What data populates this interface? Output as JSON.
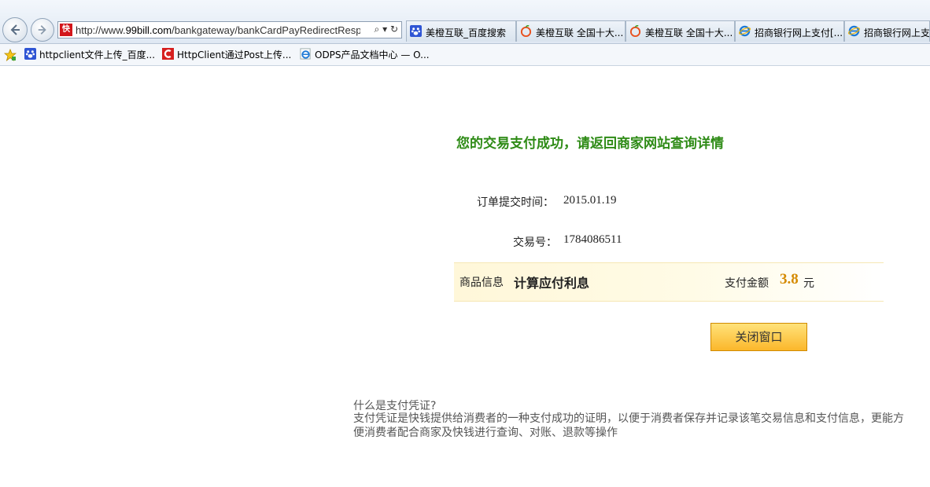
{
  "browser": {
    "url_prefix": "http://www.",
    "url_domain": "99bill.com",
    "url_path": "/bankgateway/bankCardPayRedirectResp",
    "favicon_text": "快",
    "tabs": [
      {
        "label": "美橙互联_百度搜索",
        "icon": "baidu-paw-icon"
      },
      {
        "label": "美橙互联 全国十大...",
        "icon": "apple-logo-icon"
      },
      {
        "label": "美橙互联 全国十大...",
        "icon": "apple-logo-icon"
      },
      {
        "label": "招商银行网上支付[...",
        "icon": "ie-icon"
      },
      {
        "label": "招商银行网上支",
        "icon": "ie-icon"
      }
    ],
    "favorites": [
      {
        "label": "httpclient文件上传_百度...",
        "icon": "baidu-paw-icon"
      },
      {
        "label": "HttpClient通过Post上传...",
        "icon": "c-logo-icon"
      },
      {
        "label": "ODPS产品文档中心 — O...",
        "icon": "ie-icon"
      }
    ]
  },
  "page": {
    "success_message": "您的交易支付成功，请返回商家网站查询详情",
    "order_time_label": "订单提交时间：",
    "order_time_value": "2015.01.19",
    "trade_no_label": "交易号：",
    "trade_no_value": "1784086511",
    "goods_label": "商品信息",
    "goods_name": "计算应付利息",
    "amount_label": "支付金额",
    "amount_value": "3.8",
    "amount_unit": "元",
    "close_button": "关闭窗口",
    "faq_question": "什么是支付凭证?",
    "faq_answer": "支付凭证是快钱提供给消费者的一种支付成功的证明，以便于消费者保存并记录该笔交易信息和支付信息，更能方便消费者配合商家及快钱进行查询、对账、退款等操作"
  },
  "colors": {
    "success_green": "#2e8b16",
    "amount_orange": "#d58a00",
    "button_yellow": "#fbb72b"
  }
}
